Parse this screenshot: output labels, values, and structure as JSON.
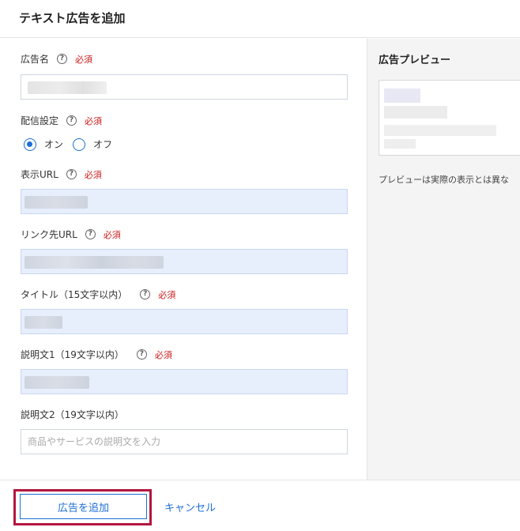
{
  "dialog": {
    "title": "テキスト広告を追加"
  },
  "form": {
    "help_glyph": "?",
    "required_text": "必須",
    "ad_name": {
      "label": "広告名",
      "value": ""
    },
    "delivery": {
      "label": "配信設定",
      "on_label": "オン",
      "off_label": "オフ",
      "selected": "オン"
    },
    "display_url": {
      "label": "表示URL",
      "value": ""
    },
    "link_url": {
      "label": "リンク先URL",
      "value": ""
    },
    "title": {
      "label": "タイトル（15文字以内）",
      "value": ""
    },
    "desc1": {
      "label": "説明文1（19文字以内）",
      "value": ""
    },
    "desc2": {
      "label": "説明文2（19文字以内）",
      "value": "",
      "placeholder": "商品やサービスの説明文を入力"
    }
  },
  "preview": {
    "title": "広告プレビュー",
    "note": "プレビューは実際の表示とは異な"
  },
  "footer": {
    "add_label": "広告を追加",
    "cancel_label": "キャンセル"
  },
  "colors": {
    "accent": "#1d6fd6",
    "required": "#cc1a1a",
    "highlight": "#b3163f",
    "filled_input": "#e7effd"
  }
}
